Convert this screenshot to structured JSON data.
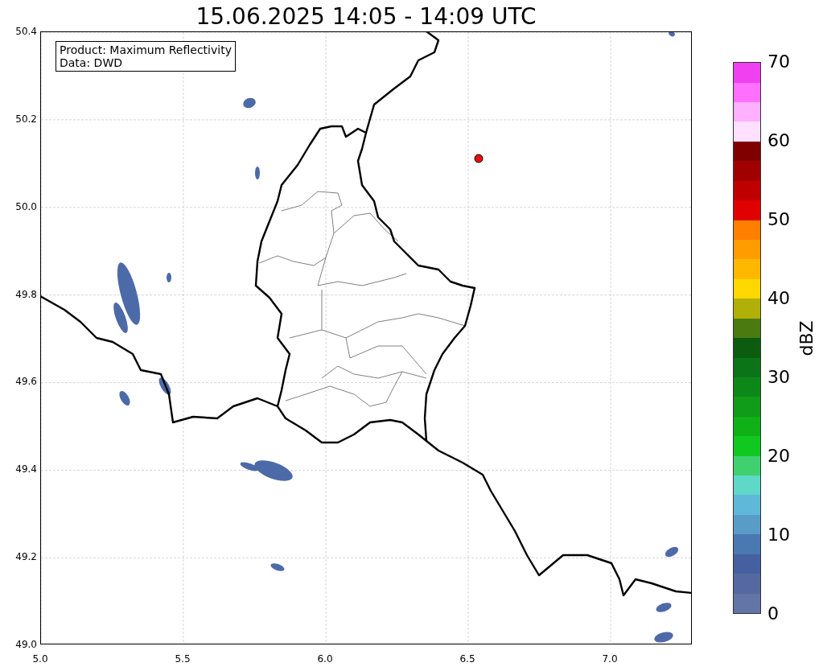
{
  "title": "15.06.2025 14:05 - 14:09 UTC",
  "map": {
    "legend": [
      "Product: Maximum Reflectivity",
      "Data: DWD"
    ],
    "x_ticks": [
      "5.0",
      "5.5",
      "6.0",
      "6.5",
      "7.0"
    ],
    "y_ticks": [
      "50.4",
      "50.2",
      "50.0",
      "49.8",
      "49.6",
      "49.4",
      "49.2",
      "49.0"
    ]
  },
  "colorbar": {
    "label": "dBZ",
    "ticks": [
      "70",
      "60",
      "50",
      "40",
      "30",
      "20",
      "10",
      "0"
    ],
    "segments": [
      {
        "color": "#6374a6"
      },
      {
        "color": "#5569a0"
      },
      {
        "color": "#4560a0"
      },
      {
        "color": "#4a78b0"
      },
      {
        "color": "#5a9cc8"
      },
      {
        "color": "#60b8d8"
      },
      {
        "color": "#60d8c8"
      },
      {
        "color": "#40d070"
      },
      {
        "color": "#10c820"
      },
      {
        "color": "#10b018"
      },
      {
        "color": "#109c18"
      },
      {
        "color": "#0c8818"
      },
      {
        "color": "#0c7418"
      },
      {
        "color": "#0c5c10"
      },
      {
        "color": "#4a7a10"
      },
      {
        "color": "#b0b008"
      },
      {
        "color": "#ffd800"
      },
      {
        "color": "#ffb800"
      },
      {
        "color": "#ff9c00"
      },
      {
        "color": "#ff8000"
      },
      {
        "color": "#e00000"
      },
      {
        "color": "#c00000"
      },
      {
        "color": "#a00000"
      },
      {
        "color": "#800000"
      },
      {
        "color": "#ffe0ff"
      },
      {
        "color": "#ffb0ff"
      },
      {
        "color": "#ff70ff"
      },
      {
        "color": "#f040f0"
      }
    ]
  }
}
